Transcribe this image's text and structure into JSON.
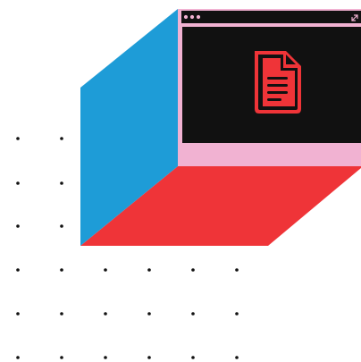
{
  "colors": {
    "background": "#ffffff",
    "side_face": "#1e9cd7",
    "bottom_face": "#ef3438",
    "window_frame": "#f1b2d2",
    "window_body": "#111111",
    "window_bar": "#111111",
    "document_icon": "#ef3438",
    "dots": "#111111"
  },
  "icons": {
    "window_controls": "three-dots-icon",
    "resize": "diagonal-resize-icon",
    "document": "document-icon"
  }
}
